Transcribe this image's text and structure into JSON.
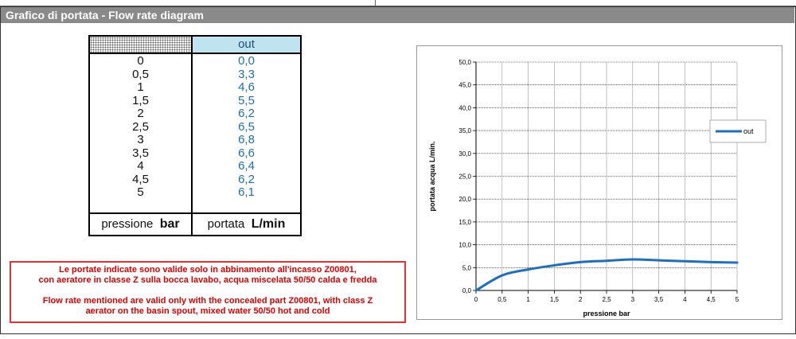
{
  "header": {
    "title": "Grafico di portata - Flow rate diagram"
  },
  "table": {
    "col_header": "out",
    "rows": [
      {
        "p": "0",
        "v": "0,0"
      },
      {
        "p": "0,5",
        "v": "3,3"
      },
      {
        "p": "1",
        "v": "4,6"
      },
      {
        "p": "1,5",
        "v": "5,5"
      },
      {
        "p": "2",
        "v": "6,2"
      },
      {
        "p": "2,5",
        "v": "6,5"
      },
      {
        "p": "3",
        "v": "6,8"
      },
      {
        "p": "3,5",
        "v": "6,6"
      },
      {
        "p": "4",
        "v": "6,4"
      },
      {
        "p": "4,5",
        "v": "6,2"
      },
      {
        "p": "5",
        "v": "6,1"
      }
    ],
    "footer_left_text": "pressione",
    "footer_left_unit": "bar",
    "footer_right_text": "portata",
    "footer_right_unit": "L/min"
  },
  "note": {
    "it_line1": "Le portate indicate sono valide solo in abbinamento all'incasso Z00801,",
    "it_line2": "con aeratore in classe Z sulla bocca lavabo, acqua miscelata 50/50 calda e fredda",
    "en_line1": "Flow rate mentioned are valid only with the concealed part Z00801, with class Z",
    "en_line2": "aerator on the basin spout, mixed water 50/50 hot and cold"
  },
  "chart_data": {
    "type": "line",
    "xlabel": "pressione bar",
    "ylabel": "portata acqua L/min.",
    "x": [
      0,
      0.5,
      1,
      1.5,
      2,
      2.5,
      3,
      3.5,
      4,
      4.5,
      5
    ],
    "series": [
      {
        "name": "out",
        "values": [
          0.0,
          3.3,
          4.6,
          5.5,
          6.2,
          6.5,
          6.8,
          6.6,
          6.4,
          6.2,
          6.1
        ],
        "color": "#1f6fc0"
      }
    ],
    "x_ticks": [
      "0",
      "0,5",
      "1",
      "1,5",
      "2",
      "2,5",
      "3",
      "3,5",
      "4",
      "4,5",
      "5"
    ],
    "y_ticks": [
      "0,0",
      "5,0",
      "10,0",
      "15,0",
      "20,0",
      "25,0",
      "30,0",
      "35,0",
      "40,0",
      "45,0",
      "50,0"
    ],
    "xlim": [
      0,
      5
    ],
    "ylim": [
      0,
      50
    ],
    "grid": true,
    "legend": "right"
  }
}
